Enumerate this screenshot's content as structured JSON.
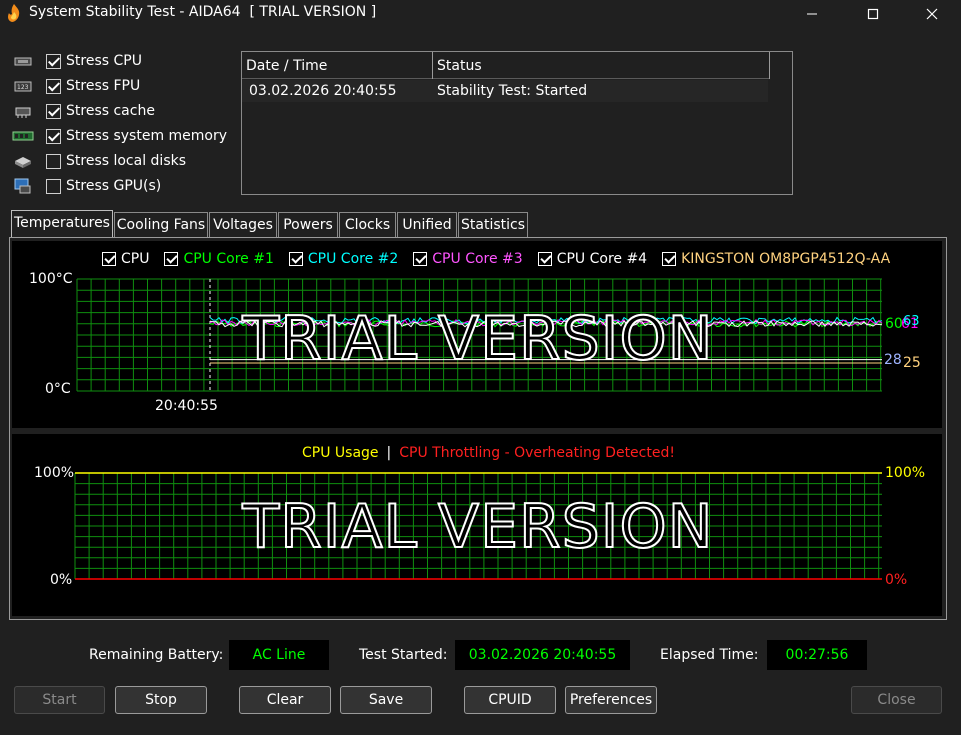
{
  "window": {
    "title": "System Stability Test - AIDA64  [ TRIAL VERSION ]"
  },
  "stress_options": [
    {
      "label": "Stress CPU",
      "checked": true,
      "icon": "cpu-chip-icon"
    },
    {
      "label": "Stress FPU",
      "checked": true,
      "icon": "fpu-chip-icon"
    },
    {
      "label": "Stress cache",
      "checked": true,
      "icon": "cache-chip-icon"
    },
    {
      "label": "Stress system memory",
      "checked": true,
      "icon": "memory-module-icon"
    },
    {
      "label": "Stress local disks",
      "checked": false,
      "icon": "disk-drive-icon"
    },
    {
      "label": "Stress GPU(s)",
      "checked": false,
      "icon": "gpu-monitor-icon"
    }
  ],
  "log": {
    "columns": [
      "Date / Time",
      "Status"
    ],
    "rows": [
      {
        "datetime": "03.02.2026 20:40:55",
        "status": "Stability Test: Started"
      }
    ]
  },
  "tabs": [
    "Temperatures",
    "Cooling Fans",
    "Voltages",
    "Powers",
    "Clocks",
    "Unified",
    "Statistics"
  ],
  "active_tab": "Temperatures",
  "temperature_chart": {
    "legend": [
      {
        "label": "CPU",
        "color": "#ffffff"
      },
      {
        "label": "CPU Core #1",
        "color": "#00ff00"
      },
      {
        "label": "CPU Core #2",
        "color": "#00ffff"
      },
      {
        "label": "CPU Core #3",
        "color": "#ff00ff"
      },
      {
        "label": "CPU Core #4",
        "color": "#ffffff"
      },
      {
        "label": "KINGSTON OM8PGP4512Q-AA",
        "color": "#ffd27f"
      }
    ],
    "y_max_label": "100°C",
    "y_min_label": "0°C",
    "time_label": "20:40:55",
    "watermark": "TRIAL VERSION",
    "right_values": [
      {
        "text": "60",
        "color": "#00ff00"
      },
      {
        "text": "60",
        "color": "#ffffff"
      },
      {
        "text": "61",
        "color": "#ff00ff"
      },
      {
        "text": "63",
        "color": "#00ffff"
      },
      {
        "text": "28",
        "color": "#9fb4ff"
      },
      {
        "text": "25",
        "color": "#ffd27f"
      }
    ]
  },
  "usage_chart": {
    "title_usage": "CPU Usage",
    "separator": "|",
    "title_throttle": "CPU Throttling - Overheating Detected!",
    "usage_color": "#ffff00",
    "throttle_color": "#ff0000",
    "left_max": "100%",
    "left_min": "0%",
    "right_max": "100%",
    "right_min": "0%",
    "watermark": "TRIAL VERSION"
  },
  "chart_data": [
    {
      "type": "line",
      "title": "",
      "ylabel": "",
      "ylim": [
        0,
        100
      ],
      "y_unit": "°C",
      "grid": true,
      "x_start_label": "20:40:55",
      "series": [
        {
          "name": "CPU Core #1",
          "latest": 60
        },
        {
          "name": "CPU Core #2",
          "latest": 63
        },
        {
          "name": "CPU Core #3",
          "latest": 61
        },
        {
          "name": "CPU Core #4",
          "latest": 60
        },
        {
          "name": "KINGSTON OM8PGP4512Q-AA",
          "latest": 25
        }
      ],
      "legend_placement": "top"
    },
    {
      "type": "line",
      "title": "CPU Usage | CPU Throttling - Overheating Detected!",
      "ylim": [
        0,
        100
      ],
      "y_unit": "%",
      "grid": true,
      "series": [
        {
          "name": "CPU Usage",
          "latest": 100
        },
        {
          "name": "CPU Throttling - Overheating Detected!",
          "latest": 0
        }
      ],
      "legend_placement": "top"
    }
  ],
  "info": {
    "battery_label": "Remaining Battery:",
    "battery_value": "AC Line",
    "started_label": "Test Started:",
    "started_value": "03.02.2026 20:40:55",
    "elapsed_label": "Elapsed Time:",
    "elapsed_value": "00:27:56"
  },
  "buttons": {
    "start": "Start",
    "stop": "Stop",
    "clear": "Clear",
    "save": "Save",
    "cpuid": "CPUID",
    "preferences": "Preferences",
    "close": "Close"
  }
}
